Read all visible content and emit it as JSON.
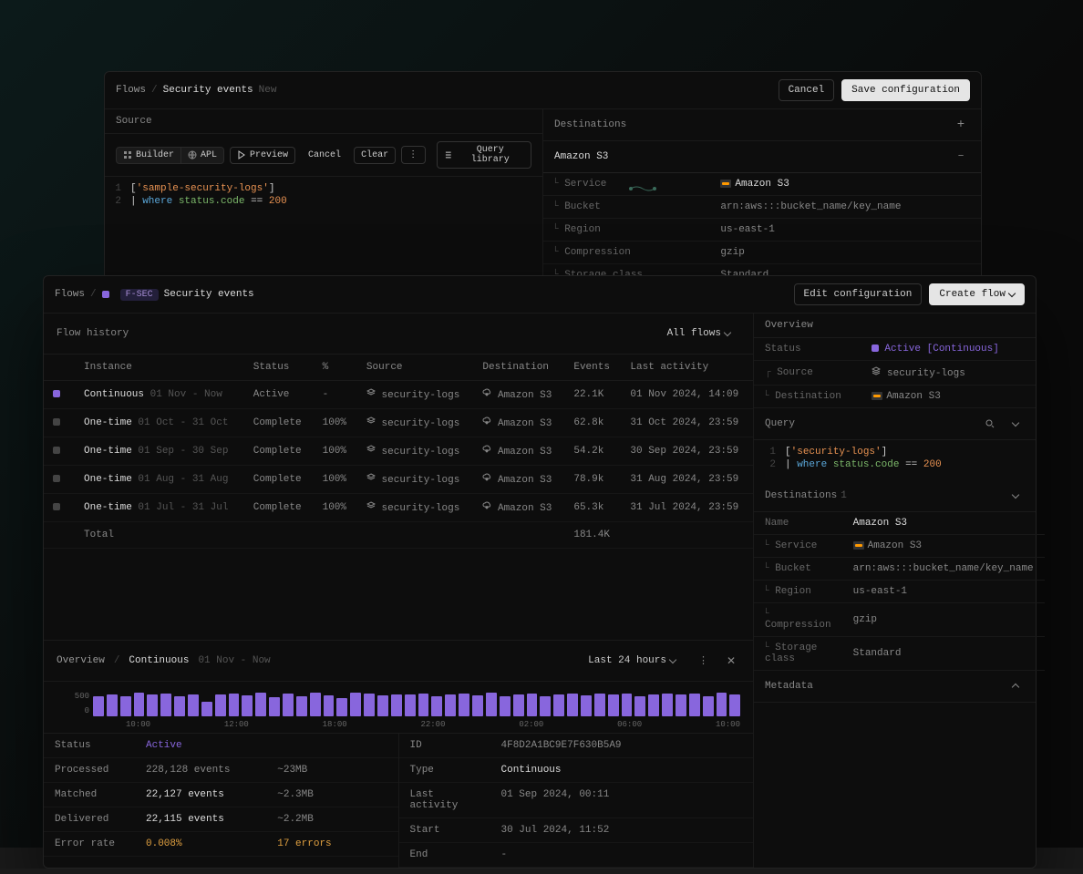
{
  "panelA": {
    "breadcrumb_root": "Flows",
    "breadcrumb_current": "Security events",
    "breadcrumb_suffix": "New",
    "cancel_button": "Cancel",
    "save_button": "Save configuration",
    "source_label": "Source",
    "builder_label": "Builder",
    "apl_label": "APL",
    "preview_label": "Preview",
    "cancel_label": "Cancel",
    "clear_label": "Clear",
    "query_library_label": "Query library",
    "code": {
      "line1": {
        "dataset": "sample-security-logs"
      },
      "line2": {
        "kw": "where",
        "field": "status.code",
        "op": "==",
        "val": "200"
      }
    },
    "destinations_label": "Destinations",
    "dest_name": "Amazon S3",
    "props": {
      "service_k": "Service",
      "service_v": "Amazon S3",
      "bucket_k": "Bucket",
      "bucket_v": "arn:aws:::bucket_name/key_name",
      "region_k": "Region",
      "region_v": "us-east-1",
      "compression_k": "Compression",
      "compression_v": "gzip",
      "storage_k": "Storage class",
      "storage_v": "Standard"
    }
  },
  "panelB": {
    "breadcrumb_root": "Flows",
    "flow_code": "F-SEC",
    "flow_name": "Security events",
    "edit_button": "Edit configuration",
    "create_button": "Create flow",
    "history_label": "Flow history",
    "filter_label": "All flows",
    "columns": {
      "instance": "Instance",
      "status": "Status",
      "pct": "%",
      "source": "Source",
      "dest": "Destination",
      "events": "Events",
      "activity": "Last activity"
    },
    "rows": [
      {
        "color": "purple",
        "type": "Continuous",
        "range": "01 Nov - Now",
        "status": "Active",
        "status_class": "active-txt",
        "pct": "-",
        "source": "security-logs",
        "dest": "Amazon S3",
        "events": "22.1K",
        "activity": "01 Nov 2024, 14:09"
      },
      {
        "color": "grey",
        "type": "One-time",
        "range": "01 Oct - 31 Oct",
        "status": "Complete",
        "pct": "100%",
        "source": "security-logs",
        "dest": "Amazon S3",
        "events": "62.8k",
        "activity": "31 Oct 2024, 23:59"
      },
      {
        "color": "grey",
        "type": "One-time",
        "range": "01 Sep - 30 Sep",
        "status": "Complete",
        "pct": "100%",
        "source": "security-logs",
        "dest": "Amazon S3",
        "events": "54.2k",
        "activity": "30 Sep 2024, 23:59"
      },
      {
        "color": "grey",
        "type": "One-time",
        "range": "01 Aug - 31 Aug",
        "status": "Complete",
        "pct": "100%",
        "source": "security-logs",
        "dest": "Amazon S3",
        "events": "78.9k",
        "activity": "31 Aug 2024, 23:59"
      },
      {
        "color": "grey",
        "type": "One-time",
        "range": "01 Jul - 31 Jul",
        "status": "Complete",
        "pct": "100%",
        "source": "security-logs",
        "dest": "Amazon S3",
        "events": "65.3k",
        "activity": "31 Jul 2024, 23:59"
      }
    ],
    "total_label": "Total",
    "total_events": "181.4K",
    "overview": {
      "label": "Overview",
      "status_k": "Status",
      "status_v": "Active [Continuous]",
      "source_k": "Source",
      "source_v": "security-logs",
      "dest_k": "Destination",
      "dest_v": "Amazon S3",
      "query_label": "Query",
      "code": {
        "line1": {
          "dataset": "security-logs"
        },
        "line2": {
          "kw": "where",
          "field": "status.code",
          "op": "==",
          "val": "200"
        }
      },
      "dest_label": "Destinations",
      "dest_count": "1",
      "name_k": "Name",
      "name_v": "Amazon S3",
      "service_k": "Service",
      "service_v": "Amazon S3",
      "bucket_k": "Bucket",
      "bucket_v": "arn:aws:::bucket_name/key_name",
      "region_k": "Region",
      "region_v": "us-east-1",
      "compression_k": "Compression",
      "compression_v": "gzip",
      "storage_k": "Storage class",
      "storage_v": "Standard",
      "metadata_label": "Metadata"
    },
    "detail": {
      "crumb_a": "Overview",
      "crumb_b": "Continuous",
      "crumb_c": "01 Nov - Now",
      "range_label": "Last 24 hours",
      "stats_left": [
        {
          "k": "Status",
          "v": "Active",
          "v2": "",
          "cls": "active-txt"
        },
        {
          "k": "Processed",
          "v": "228,128 events",
          "v2": "~23MB"
        },
        {
          "k": "Matched",
          "v": "22,127 events",
          "v2": "~2.3MB",
          "cls": "bright"
        },
        {
          "k": "Delivered",
          "v": "22,115 events",
          "v2": "~2.2MB",
          "cls": "bright"
        },
        {
          "k": "Error rate",
          "v": "0.008%",
          "v2": "17 errors",
          "cls": "warn",
          "cls2": "warn"
        }
      ],
      "stats_right": [
        {
          "k": "ID",
          "v": "4F8D2A1BC9E7F630B5A9"
        },
        {
          "k": "Type",
          "v": "Continuous",
          "cls": "bright"
        },
        {
          "k": "Last activity",
          "v": "01 Sep 2024, 00:11"
        },
        {
          "k": "Start",
          "v": "30 Jul 2024, 11:52"
        },
        {
          "k": "End",
          "v": "-"
        }
      ]
    }
  },
  "chart_data": {
    "type": "bar",
    "title": "",
    "xlabel": "",
    "ylabel": "",
    "ylim": [
      0,
      500
    ],
    "categories": [
      "10:00",
      "12:00",
      "18:00",
      "22:00",
      "02:00",
      "06:00",
      "10:00"
    ],
    "values": [
      390,
      420,
      400,
      460,
      420,
      440,
      400,
      430,
      280,
      430,
      440,
      410,
      460,
      380,
      440,
      400,
      460,
      410,
      350,
      460,
      440,
      410,
      430,
      420,
      450,
      400,
      420,
      440,
      410,
      460,
      400,
      430,
      440,
      390,
      420,
      450,
      410,
      440,
      420,
      450,
      400,
      430,
      440,
      420,
      440,
      400,
      460,
      420
    ]
  }
}
